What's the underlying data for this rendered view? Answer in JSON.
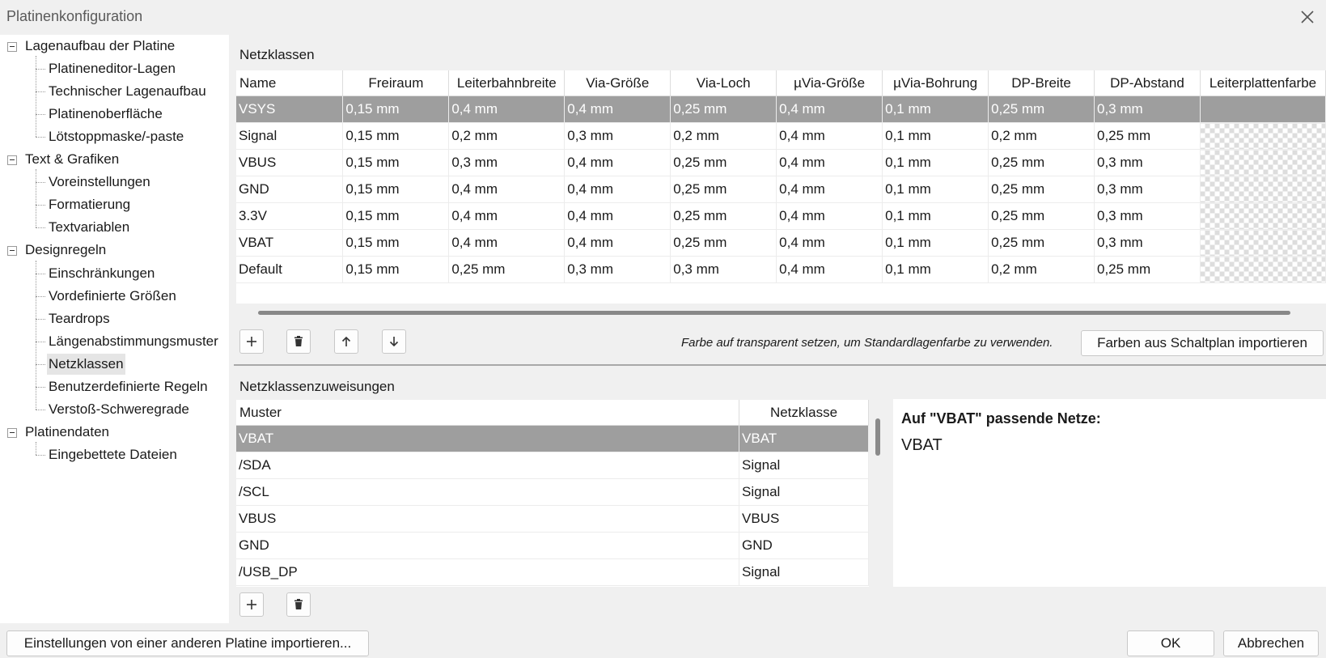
{
  "window": {
    "title": "Platinenkonfiguration",
    "close_icon": "close-icon"
  },
  "tree": {
    "groups": [
      {
        "label": "Lagenaufbau der Platine",
        "items": [
          "Platineneditor-Lagen",
          "Technischer Lagenaufbau",
          "Platinenoberfläche",
          "Lötstoppmaske/-paste"
        ]
      },
      {
        "label": "Text & Grafiken",
        "items": [
          "Voreinstellungen",
          "Formatierung",
          "Textvariablen"
        ]
      },
      {
        "label": "Designregeln",
        "items": [
          "Einschränkungen",
          "Vordefinierte Größen",
          "Teardrops",
          "Längenabstimmungsmuster",
          "Netzklassen",
          "Benutzerdefinierte Regeln",
          "Verstoß-Schweregrade"
        ]
      },
      {
        "label": "Platinendaten",
        "items": [
          "Eingebettete Dateien"
        ]
      }
    ],
    "selected": "Netzklassen"
  },
  "netclasses": {
    "title": "Netzklassen",
    "columns": [
      "Name",
      "Freiraum",
      "Leiterbahnbreite",
      "Via-Größe",
      "Via-Loch",
      "µVia-Größe",
      "µVia-Bohrung",
      "DP-Breite",
      "DP-Abstand",
      "Leiterplattenfarbe"
    ],
    "rows": [
      [
        "VSYS",
        "0,15 mm",
        "0,4 mm",
        "0,4 mm",
        "0,25 mm",
        "0,4 mm",
        "0,1 mm",
        "0,25 mm",
        "0,3 mm"
      ],
      [
        "Signal",
        "0,15 mm",
        "0,2 mm",
        "0,3 mm",
        "0,2 mm",
        "0,4 mm",
        "0,1 mm",
        "0,2 mm",
        "0,25 mm"
      ],
      [
        "VBUS",
        "0,15 mm",
        "0,3 mm",
        "0,4 mm",
        "0,25 mm",
        "0,4 mm",
        "0,1 mm",
        "0,25 mm",
        "0,3 mm"
      ],
      [
        "GND",
        "0,15 mm",
        "0,4 mm",
        "0,4 mm",
        "0,25 mm",
        "0,4 mm",
        "0,1 mm",
        "0,25 mm",
        "0,3 mm"
      ],
      [
        "3.3V",
        "0,15 mm",
        "0,4 mm",
        "0,4 mm",
        "0,25 mm",
        "0,4 mm",
        "0,1 mm",
        "0,25 mm",
        "0,3 mm"
      ],
      [
        "VBAT",
        "0,15 mm",
        "0,4 mm",
        "0,4 mm",
        "0,25 mm",
        "0,4 mm",
        "0,1 mm",
        "0,25 mm",
        "0,3 mm"
      ],
      [
        "Default",
        "0,15 mm",
        "0,25 mm",
        "0,3 mm",
        "0,3 mm",
        "0,4 mm",
        "0,1 mm",
        "0,2 mm",
        "0,25 mm"
      ]
    ],
    "selected_row": 0,
    "hint": "Farbe auf transparent setzen, um Standardlagenfarbe zu verwenden.",
    "import_colors_label": "Farben aus Schaltplan importieren",
    "toolbar_icons": [
      "add-icon",
      "trash-icon",
      "arrow-up-icon",
      "arrow-down-icon"
    ]
  },
  "assignments": {
    "title": "Netzklassenzuweisungen",
    "columns": [
      "Muster",
      "Netzklasse"
    ],
    "rows": [
      [
        "VBAT",
        "VBAT"
      ],
      [
        "/SDA",
        "Signal"
      ],
      [
        "/SCL",
        "Signal"
      ],
      [
        "VBUS",
        "VBUS"
      ],
      [
        "GND",
        "GND"
      ],
      [
        "/USB_DP",
        "Signal"
      ]
    ],
    "selected_row": 0,
    "toolbar_icons": [
      "add-icon",
      "trash-icon"
    ]
  },
  "matches": {
    "title": "Auf \"VBAT\" passende Netze:",
    "nets": [
      "VBAT"
    ]
  },
  "footer": {
    "import_label": "Einstellungen von einer anderen Platine importieren...",
    "ok_label": "OK",
    "cancel_label": "Abbrechen"
  }
}
